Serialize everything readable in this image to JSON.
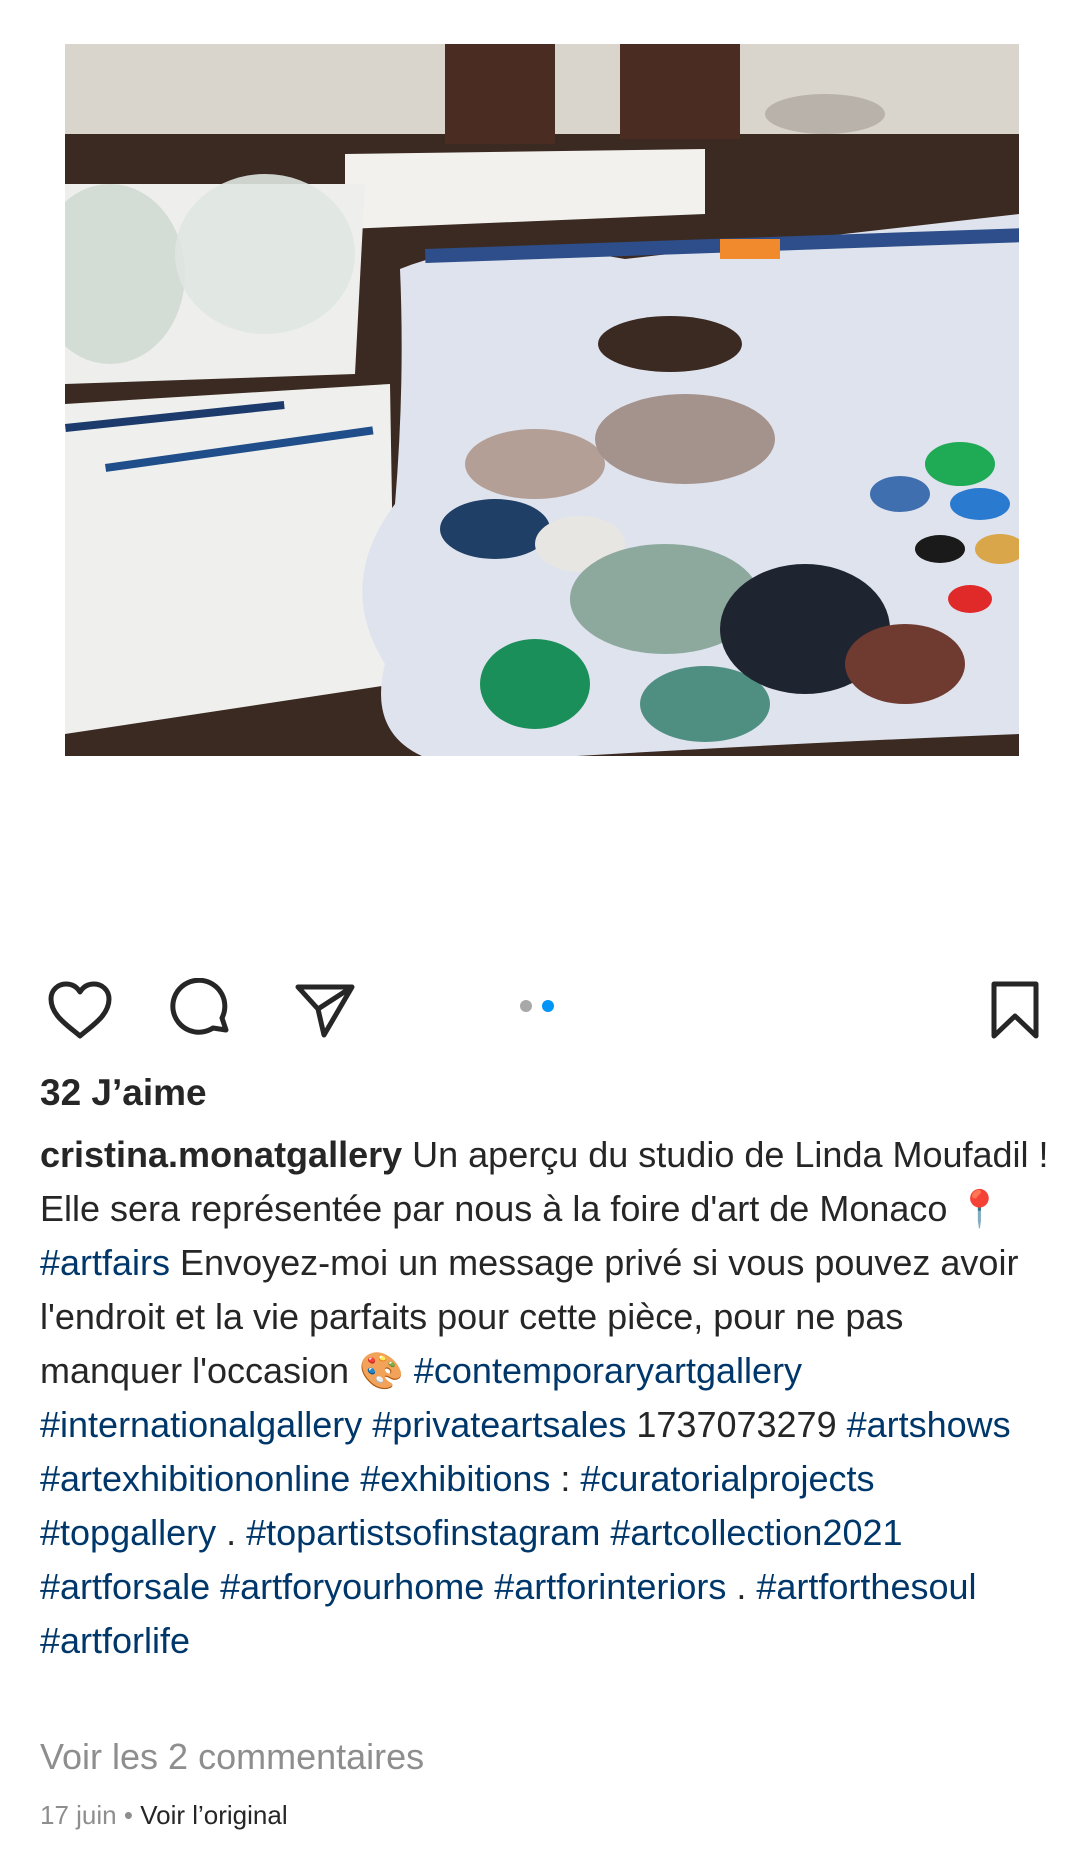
{
  "post": {
    "image_alt": "Palette de peinture dans l'atelier",
    "carousel": {
      "total": 2,
      "active": 2
    },
    "likes_label": "32 J’aime",
    "username": "cristina.monatgallery",
    "caption": [
      {
        "type": "text",
        "value": " Un aperçu du studio de Linda Moufadil ! Elle sera représentée par nous à la foire d'art de Monaco 📍 "
      },
      {
        "type": "tag",
        "value": "#artfairs"
      },
      {
        "type": "text",
        "value": " Envoyez-moi un message privé si vous pouvez avoir l'endroit et la vie parfaits pour cette pièce, pour ne pas manquer l'occasion 🎨 "
      },
      {
        "type": "tag",
        "value": "#contemporaryartgallery"
      },
      {
        "type": "text",
        "value": " "
      },
      {
        "type": "tag",
        "value": "#internationalgallery"
      },
      {
        "type": "text",
        "value": " "
      },
      {
        "type": "tag",
        "value": "#privateartsales"
      },
      {
        "type": "text",
        "value": " 1737073279 "
      },
      {
        "type": "tag",
        "value": "#artshows"
      },
      {
        "type": "text",
        "value": " "
      },
      {
        "type": "tag",
        "value": "#artexhibitiononline"
      },
      {
        "type": "text",
        "value": " "
      },
      {
        "type": "tag",
        "value": "#exhibitions"
      },
      {
        "type": "text",
        "value": " : "
      },
      {
        "type": "tag",
        "value": "#curatorialprojects"
      },
      {
        "type": "text",
        "value": " "
      },
      {
        "type": "tag",
        "value": "#topgallery"
      },
      {
        "type": "text",
        "value": " . "
      },
      {
        "type": "tag",
        "value": "#topartistsofinstagram"
      },
      {
        "type": "text",
        "value": " "
      },
      {
        "type": "tag",
        "value": "#artcollection2021"
      },
      {
        "type": "text",
        "value": " "
      },
      {
        "type": "tag",
        "value": "#artforsale"
      },
      {
        "type": "text",
        "value": " "
      },
      {
        "type": "tag",
        "value": "#artforyourhome"
      },
      {
        "type": "text",
        "value": " "
      },
      {
        "type": "tag",
        "value": "#artforinteriors"
      },
      {
        "type": "text",
        "value": " . "
      },
      {
        "type": "tag",
        "value": "#artforthesoul"
      },
      {
        "type": "text",
        "value": " "
      },
      {
        "type": "tag",
        "value": "#artforlife"
      }
    ],
    "view_comments_label": "Voir les 2 commentaires",
    "date": "17 juin",
    "separator": "•",
    "see_original_label": "Voir l’original"
  },
  "icons": {
    "like": "heart-icon",
    "comment": "comment-icon",
    "share": "send-icon",
    "save": "bookmark-icon"
  },
  "colors": {
    "text": "#262626",
    "hashtag": "#00376b",
    "muted": "#8e8e8e",
    "dot_active": "#0095f6",
    "dot_inactive": "#a8a8a8"
  }
}
